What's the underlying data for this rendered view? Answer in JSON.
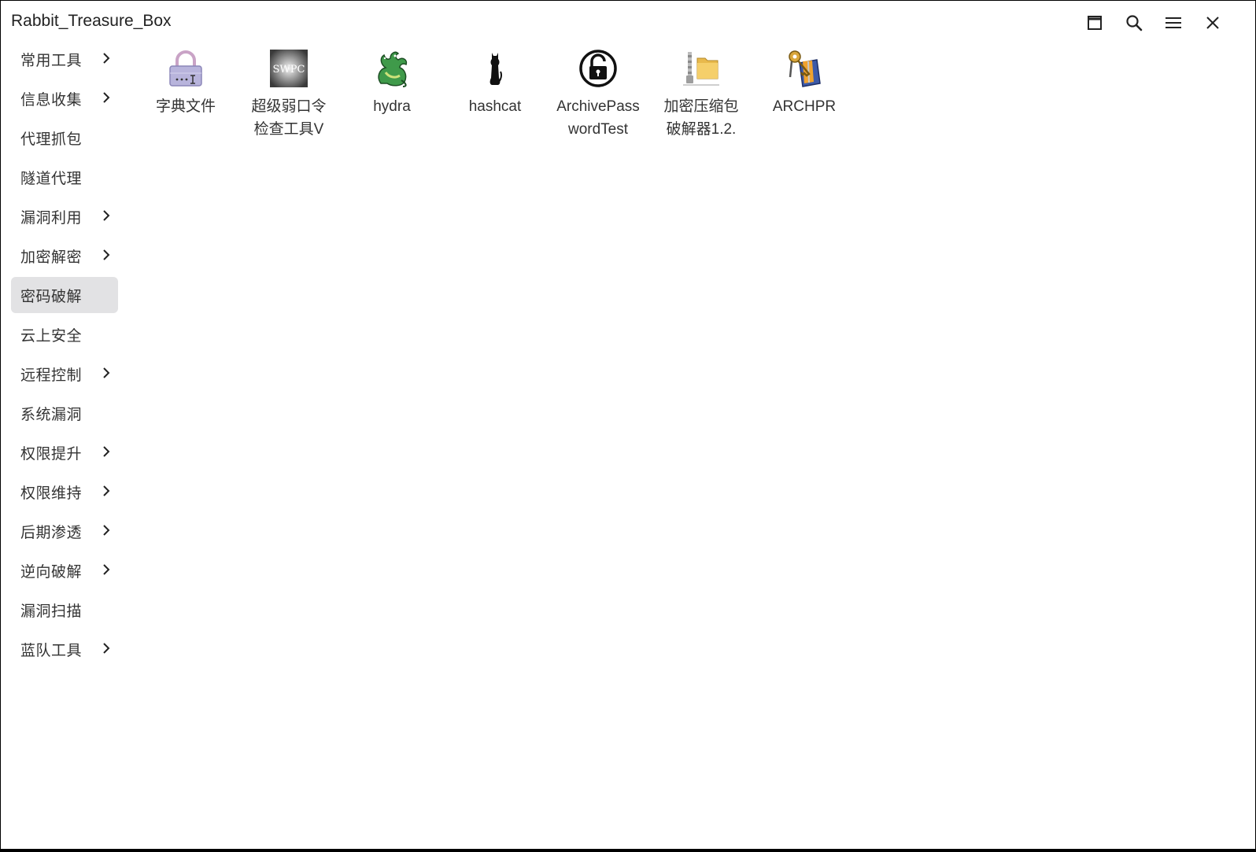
{
  "window": {
    "title": "Rabbit_Treasure_Box"
  },
  "controls": [
    {
      "name": "maximize-button",
      "icon": "maximize-icon"
    },
    {
      "name": "search-button",
      "icon": "search-icon"
    },
    {
      "name": "menu-button",
      "icon": "hamburger-menu-icon"
    },
    {
      "name": "close-button",
      "icon": "close-icon"
    }
  ],
  "sidebar": {
    "items": [
      {
        "label": "常用工具",
        "has_submenu": true
      },
      {
        "label": "信息收集",
        "has_submenu": true
      },
      {
        "label": "代理抓包",
        "has_submenu": false
      },
      {
        "label": "隧道代理",
        "has_submenu": false
      },
      {
        "label": "漏洞利用",
        "has_submenu": true
      },
      {
        "label": "加密解密",
        "has_submenu": true
      },
      {
        "label": "密码破解",
        "has_submenu": false,
        "active": true
      },
      {
        "label": "云上安全",
        "has_submenu": false
      },
      {
        "label": "远程控制",
        "has_submenu": true
      },
      {
        "label": "系统漏洞",
        "has_submenu": false
      },
      {
        "label": "权限提升",
        "has_submenu": true
      },
      {
        "label": "权限维持",
        "has_submenu": true
      },
      {
        "label": "后期渗透",
        "has_submenu": true
      },
      {
        "label": "逆向破解",
        "has_submenu": true
      },
      {
        "label": "漏洞扫描",
        "has_submenu": false
      },
      {
        "label": "蓝队工具",
        "has_submenu": true
      }
    ]
  },
  "tools": [
    {
      "label": "字典文件",
      "icon": "padlock-dictionary-icon"
    },
    {
      "label": "超级弱口令检查工具V",
      "icon": "swpc-icon",
      "icon_text": "SWPC"
    },
    {
      "label": "hydra",
      "icon": "hydra-dragon-icon"
    },
    {
      "label": "hashcat",
      "icon": "hashcat-cat-icon"
    },
    {
      "label": "ArchivePasswordTest",
      "icon": "unlocked-padlock-icon"
    },
    {
      "label": "加密压缩包破解器1.2.",
      "icon": "zip-folder-icon"
    },
    {
      "label": "ARCHPR",
      "icon": "archpr-keys-icon"
    }
  ],
  "colors": {
    "active_bg": "#e2e2e4",
    "text": "#333333"
  }
}
